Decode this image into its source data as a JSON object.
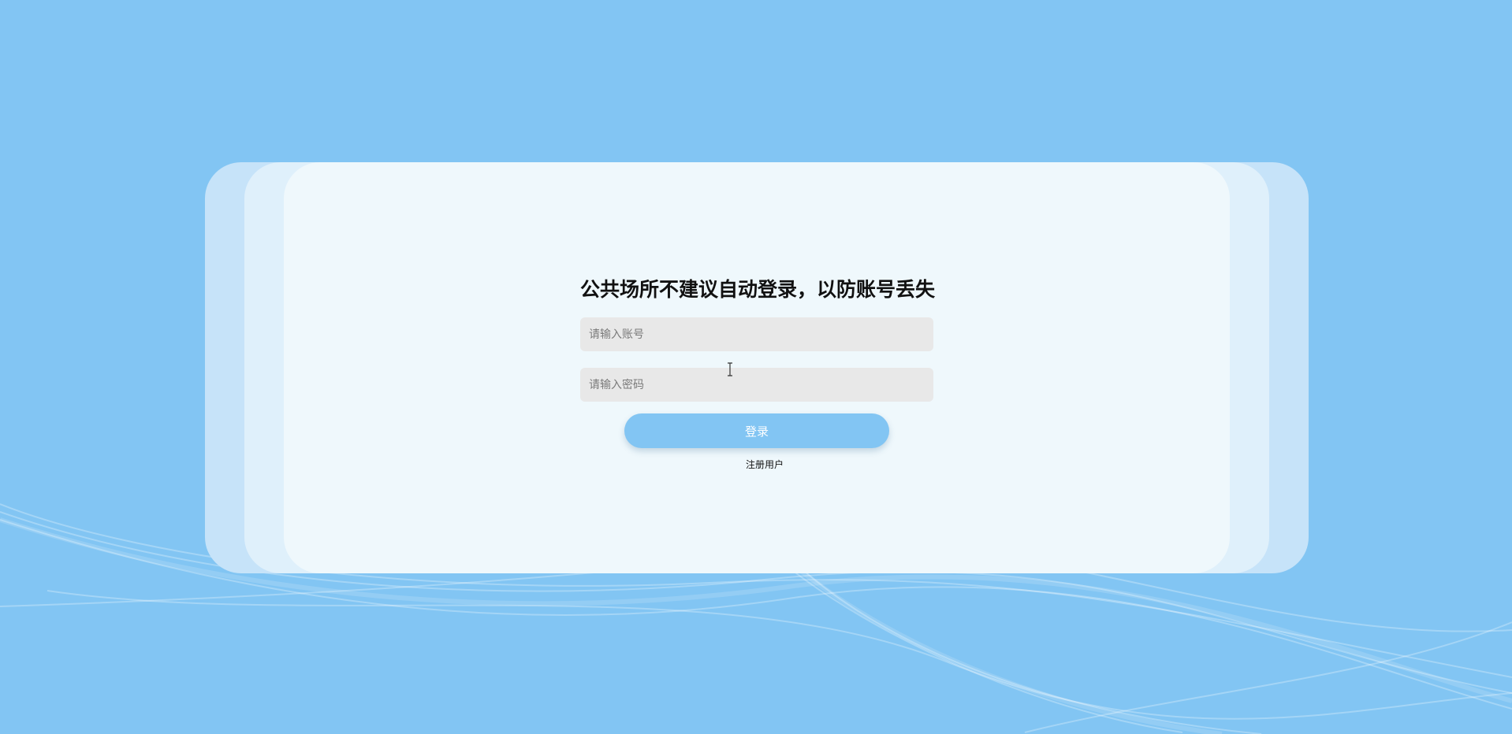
{
  "login": {
    "title": "公共场所不建议自动登录，以防账号丢失",
    "account_placeholder": "请输入账号",
    "account_value": "",
    "password_placeholder": "请输入密码",
    "password_value": "",
    "login_label": "登录",
    "register_label": "注册用户"
  },
  "colors": {
    "background": "#82c5f3",
    "card_outer": "#c6e3f9",
    "card_middle": "#dff0fb",
    "card_inner": "#eff8fc",
    "input_background": "#e8e8e8",
    "button": "#82c5f3"
  },
  "icons": {
    "cursor": "text-cursor-icon"
  }
}
